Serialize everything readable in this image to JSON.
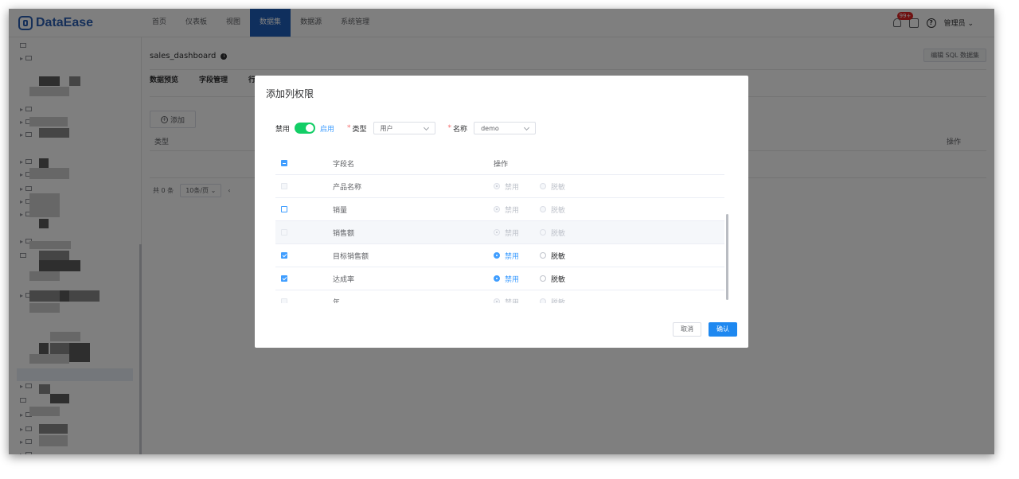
{
  "app": {
    "logo": "DataEase"
  },
  "nav": {
    "items": [
      {
        "label": "首页"
      },
      {
        "label": "仪表板"
      },
      {
        "label": "视图"
      },
      {
        "label": "数据集",
        "active": true
      },
      {
        "label": "数据源"
      },
      {
        "label": "系统管理"
      }
    ]
  },
  "header": {
    "badge": "99+",
    "user": "管理员"
  },
  "main": {
    "dataset_name": "sales_dashboard",
    "edit_sql": "编辑 SQL 数据集",
    "tabs": [
      "数据预览",
      "字段管理",
      "行"
    ],
    "add_label": "添加",
    "col_type": "类型",
    "col_op": "操作",
    "total": "共 0 条",
    "page_size": "10条/页"
  },
  "dialog": {
    "title": "添加列权限",
    "disable_label": "禁用",
    "enable_label": "启用",
    "type_label": "类型",
    "type_value": "用户",
    "name_label": "名称",
    "name_value": "demo",
    "col_field": "字段名",
    "col_op": "操作",
    "opt_disable": "禁用",
    "opt_mask": "脱敏",
    "rows": [
      {
        "field": "产品名称",
        "checked": false,
        "disabled": true,
        "option": "禁用"
      },
      {
        "field": "销量",
        "checked": false,
        "disabled": false,
        "option": "禁用"
      },
      {
        "field": "销售额",
        "checked": false,
        "disabled": true,
        "option": "禁用"
      },
      {
        "field": "目标销售额",
        "checked": true,
        "disabled": false,
        "option": "禁用"
      },
      {
        "field": "达成率",
        "checked": true,
        "disabled": false,
        "option": "禁用"
      },
      {
        "field": "年",
        "checked": false,
        "disabled": true,
        "option": "禁用"
      }
    ],
    "cancel": "取消",
    "confirm": "确认"
  }
}
